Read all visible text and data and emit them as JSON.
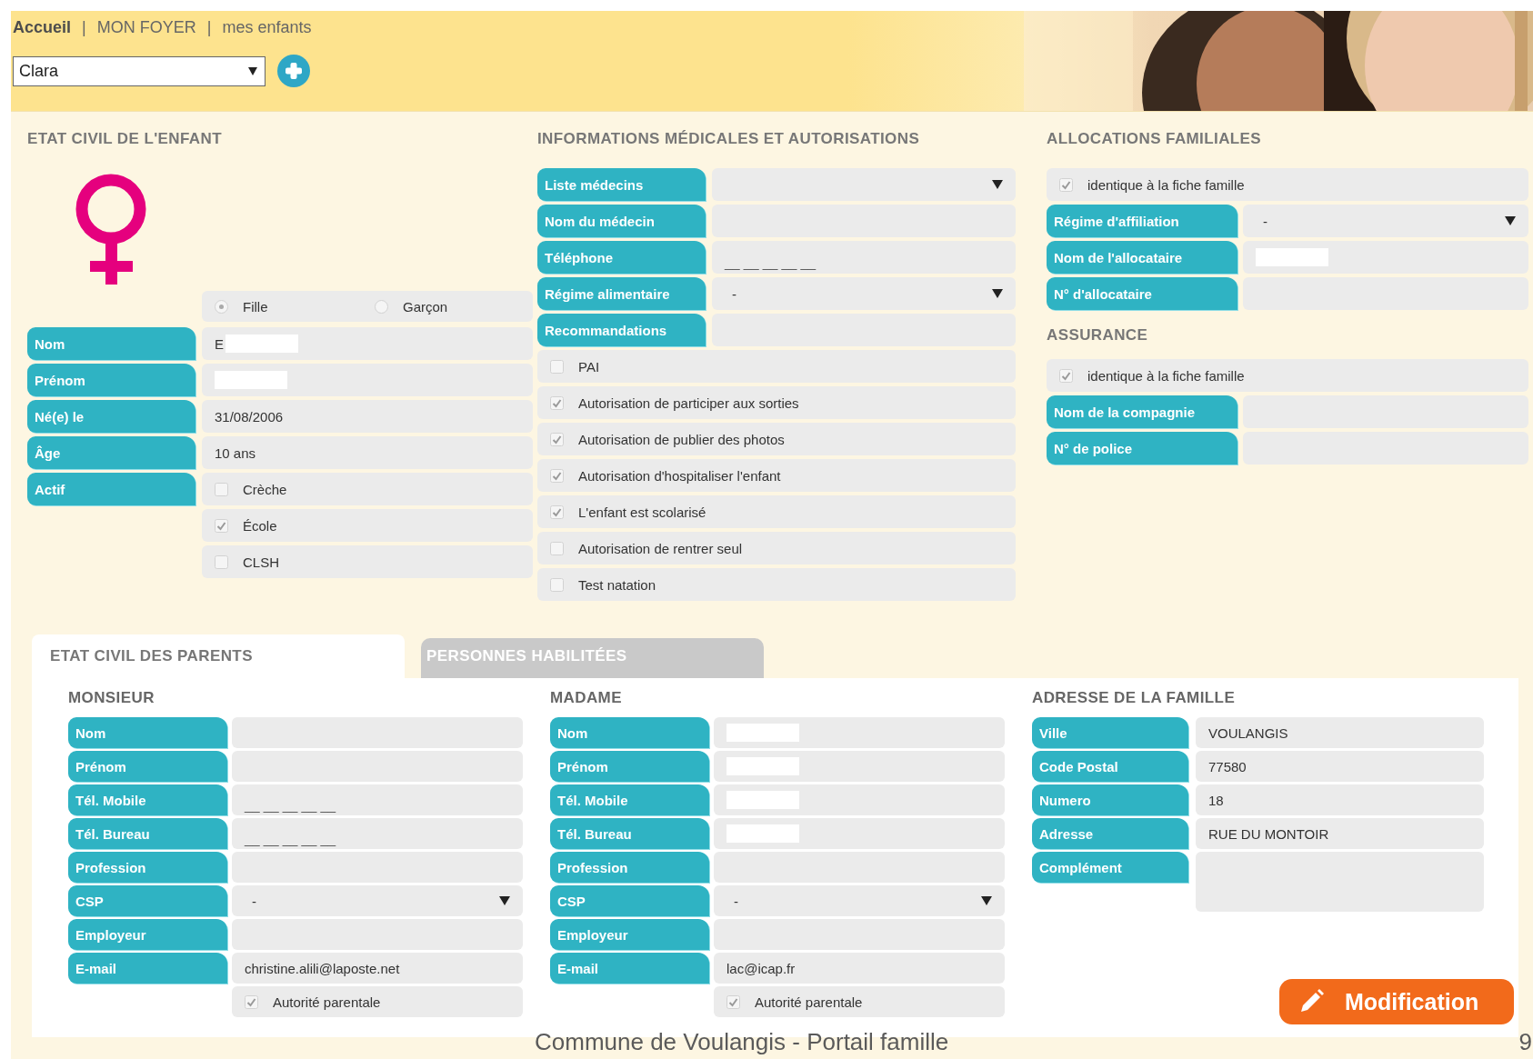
{
  "breadcrumb": {
    "separator": "|",
    "items": [
      "Accueil",
      "MON FOYER",
      "mes enfants"
    ]
  },
  "child_select": {
    "value": "Clara"
  },
  "child_civil": {
    "title": "ETAT CIVIL DE L'ENFANT",
    "fields": [
      {
        "kind": "gender",
        "options": [
          {
            "label": "Fille",
            "selected": true
          },
          {
            "label": "Garçon",
            "selected": false
          }
        ]
      },
      {
        "kind": "text",
        "label": "Nom",
        "value": "E",
        "redacted": true
      },
      {
        "kind": "text",
        "label": "Prénom",
        "redacted": true
      },
      {
        "kind": "text",
        "label": "Né(e) le",
        "value": "31/08/2006"
      },
      {
        "kind": "text",
        "label": "Âge",
        "value": "10 ans"
      },
      {
        "kind": "checks",
        "label": "Actif",
        "options": [
          {
            "label": "Crèche",
            "checked": false
          },
          {
            "label": "École",
            "checked": true
          },
          {
            "label": "CLSH",
            "checked": false
          }
        ]
      }
    ]
  },
  "medical": {
    "title": "INFORMATIONS MÉDICALES ET AUTORISATIONS",
    "fields": [
      {
        "kind": "select",
        "label": "Liste médecins"
      },
      {
        "kind": "text",
        "label": "Nom du médecin"
      },
      {
        "kind": "text",
        "label": "Téléphone",
        "placeholder": "__ __ __ __ __"
      },
      {
        "kind": "select",
        "label": "Régime alimentaire",
        "value": "-"
      },
      {
        "kind": "text",
        "label": "Recommandations"
      },
      {
        "kind": "check",
        "label": "PAI",
        "checked": false
      },
      {
        "kind": "check",
        "label": "Autorisation de participer aux sorties",
        "checked": true
      },
      {
        "kind": "check",
        "label": "Autorisation de publier des photos",
        "checked": true
      },
      {
        "kind": "check",
        "label": "Autorisation d'hospitaliser l'enfant",
        "checked": true
      },
      {
        "kind": "check",
        "label": "L'enfant est scolarisé",
        "checked": true
      },
      {
        "kind": "check",
        "label": "Autorisation de rentrer seul",
        "checked": false
      },
      {
        "kind": "check",
        "label": "Test natation",
        "checked": false
      }
    ]
  },
  "allocations": {
    "title": "ALLOCATIONS FAMILIALES",
    "fields": [
      {
        "kind": "check",
        "label": "identique à la fiche famille",
        "checked": true
      },
      {
        "kind": "select",
        "label": "Régime d'affiliation",
        "value": "-"
      },
      {
        "kind": "text",
        "label": "Nom de l'allocataire",
        "redacted": true
      },
      {
        "kind": "text",
        "label": "N° d'allocataire"
      }
    ]
  },
  "insurance": {
    "title": "ASSURANCE",
    "fields": [
      {
        "kind": "check",
        "label": "identique à la fiche famille",
        "checked": true
      },
      {
        "kind": "text",
        "label": "Nom de la compagnie"
      },
      {
        "kind": "text",
        "label": "N° de police"
      }
    ]
  },
  "tabs": [
    {
      "label": "ETAT CIVIL DES PARENTS",
      "selected": true
    },
    {
      "label": "PERSONNES HABILITÉES",
      "selected": false
    }
  ],
  "parents": [
    {
      "title": "MONSIEUR",
      "fields": [
        {
          "kind": "text",
          "label": "Nom"
        },
        {
          "kind": "text",
          "label": "Prénom"
        },
        {
          "kind": "text",
          "label": "Tél. Mobile",
          "placeholder": "__ __ __ __ __"
        },
        {
          "kind": "text",
          "label": "Tél. Bureau",
          "placeholder": "__ __ __ __ __"
        },
        {
          "kind": "text",
          "label": "Profession"
        },
        {
          "kind": "select",
          "label": "CSP",
          "value": "-"
        },
        {
          "kind": "text",
          "label": "Employeur"
        },
        {
          "kind": "text",
          "label": "E-mail",
          "value": "christine.alili@laposte.net"
        },
        {
          "kind": "checks",
          "options": [
            {
              "label": "Autorité parentale",
              "checked": true
            }
          ]
        }
      ]
    },
    {
      "title": "MADAME",
      "fields": [
        {
          "kind": "text",
          "label": "Nom",
          "redacted": true
        },
        {
          "kind": "text",
          "label": "Prénom",
          "redacted": true
        },
        {
          "kind": "text",
          "label": "Tél. Mobile",
          "redacted": true
        },
        {
          "kind": "text",
          "label": "Tél. Bureau",
          "redacted": true
        },
        {
          "kind": "text",
          "label": "Profession"
        },
        {
          "kind": "select",
          "label": "CSP",
          "value": "-"
        },
        {
          "kind": "text",
          "label": "Employeur"
        },
        {
          "kind": "text",
          "label": "E-mail",
          "value": "lac@icap.fr"
        },
        {
          "kind": "checks",
          "options": [
            {
              "label": "Autorité parentale",
              "checked": true
            }
          ]
        }
      ]
    }
  ],
  "family_address": {
    "title": "ADRESSE DE LA FAMILLE",
    "fields": [
      {
        "kind": "text",
        "label": "Ville",
        "value": "VOULANGIS"
      },
      {
        "kind": "text",
        "label": "Code Postal",
        "value": "77580"
      },
      {
        "kind": "text",
        "label": "Numero",
        "value": "18"
      },
      {
        "kind": "text",
        "label": "Adresse",
        "value": "RUE DU MONTOIR"
      },
      {
        "kind": "textarea",
        "label": "Complément"
      }
    ]
  },
  "edit_button": {
    "label": "Modification"
  },
  "footer": {
    "text": "Commune de Voulangis - Portail famille",
    "page": "9"
  }
}
